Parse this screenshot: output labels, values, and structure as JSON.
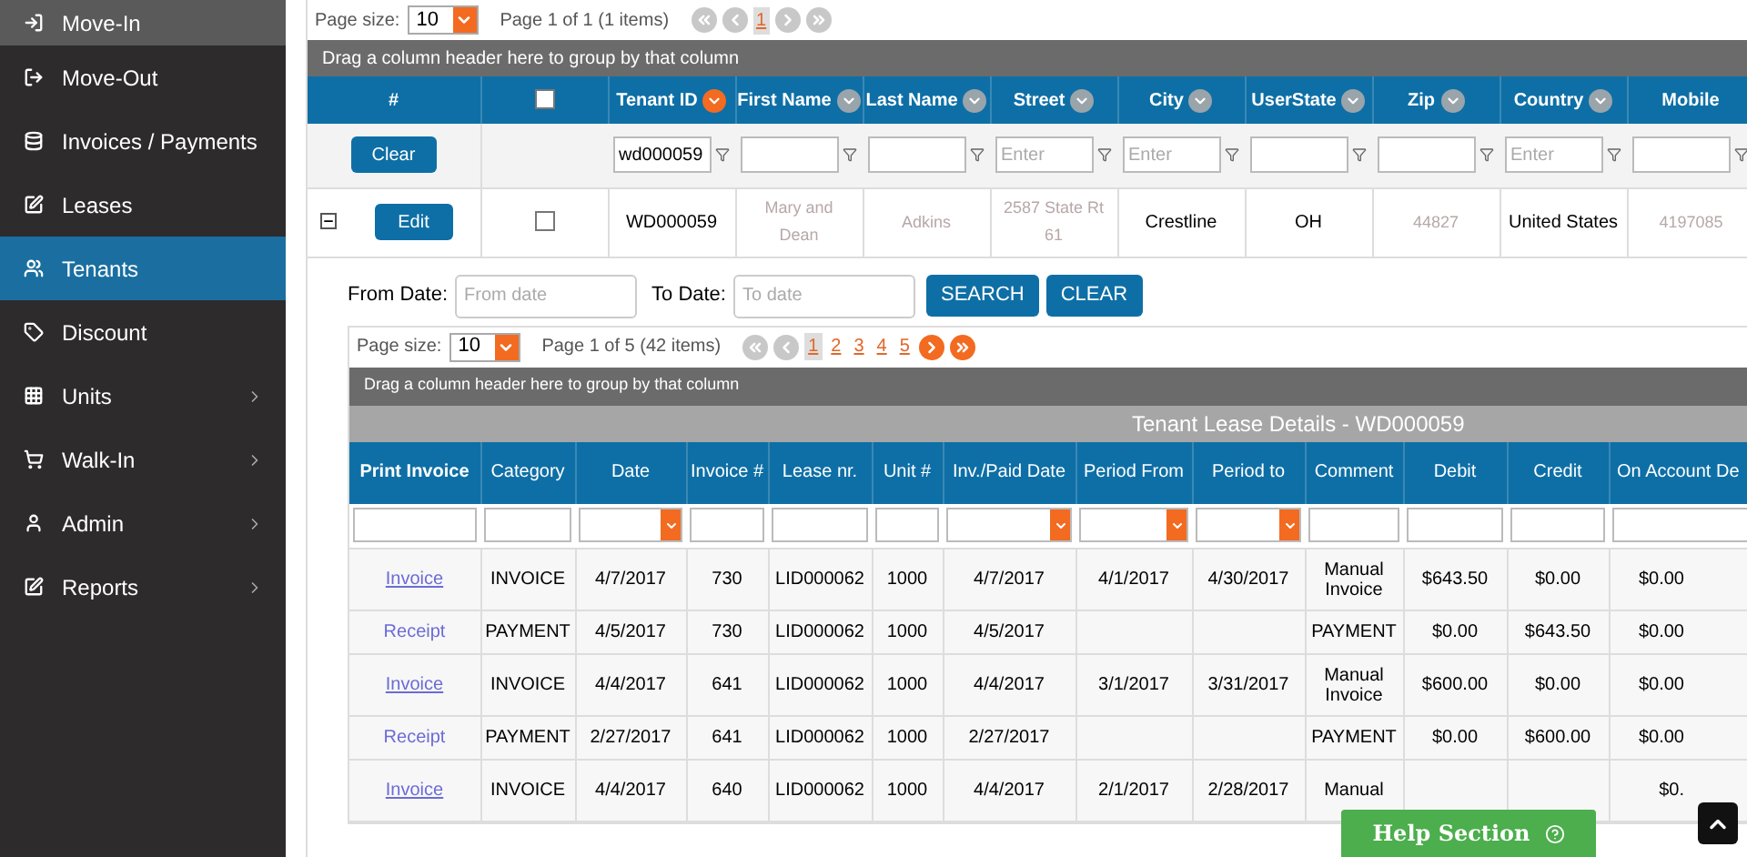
{
  "sidebar": {
    "items": [
      {
        "label": "Move-In",
        "selected": false,
        "hover": true,
        "submenu": false
      },
      {
        "label": "Move-Out",
        "selected": false,
        "hover": false,
        "submenu": false
      },
      {
        "label": "Invoices / Payments",
        "selected": false,
        "hover": false,
        "submenu": false
      },
      {
        "label": "Leases",
        "selected": false,
        "hover": false,
        "submenu": false
      },
      {
        "label": "Tenants",
        "selected": true,
        "hover": false,
        "submenu": false
      },
      {
        "label": "Discount",
        "selected": false,
        "hover": false,
        "submenu": false
      },
      {
        "label": "Units",
        "selected": false,
        "hover": false,
        "submenu": true
      },
      {
        "label": "Walk-In",
        "selected": false,
        "hover": false,
        "submenu": true
      },
      {
        "label": "Admin",
        "selected": false,
        "hover": false,
        "submenu": true
      },
      {
        "label": "Reports",
        "selected": false,
        "hover": false,
        "submenu": true
      }
    ]
  },
  "tenant_grid": {
    "page_size_label": "Page size:",
    "page_size": "10",
    "page_info": "Page 1 of 1 (1 items)",
    "pages": [
      {
        "label": "1",
        "selected": true
      }
    ],
    "next_enabled": false,
    "group_hint": "Drag a column header here to group by that column",
    "columns": [
      {
        "label": "#",
        "kind": "plain"
      },
      {
        "kind": "checkbox",
        "checked": false
      },
      {
        "label": "Tenant ID",
        "kind": "menu",
        "sorted": true
      },
      {
        "label": "First Name",
        "kind": "menu",
        "sorted": false
      },
      {
        "label": "Last Name",
        "kind": "menu",
        "sorted": false
      },
      {
        "label": "Street",
        "kind": "menu",
        "sorted": false
      },
      {
        "label": "City",
        "kind": "menu",
        "sorted": false
      },
      {
        "label": "UserState",
        "kind": "menu",
        "sorted": false
      },
      {
        "label": "Zip",
        "kind": "menu",
        "sorted": false
      },
      {
        "label": "Country",
        "kind": "menu",
        "sorted": false
      },
      {
        "label": "Mobile",
        "kind": "plain"
      }
    ],
    "clear_button": "Clear",
    "filters": [
      {
        "kind": "typed",
        "value": "wd000059"
      },
      {
        "kind": "blank"
      },
      {
        "kind": "blank"
      },
      {
        "kind": "hint",
        "placeholder": "Enter"
      },
      {
        "kind": "hint",
        "placeholder": "Enter"
      },
      {
        "kind": "blank"
      },
      {
        "kind": "blank"
      },
      {
        "kind": "hint",
        "placeholder": "Enter"
      },
      {
        "kind": "blank"
      }
    ],
    "row": {
      "expanded": true,
      "edit_button": "Edit",
      "checked": false,
      "cells": [
        "WD000059",
        "Mary and Dean",
        "Adkins",
        "2587 State Rt 61",
        "Crestline",
        "OH",
        "44827",
        "United States",
        "4197085"
      ],
      "redacted": [
        false,
        true,
        true,
        true,
        false,
        false,
        true,
        false,
        true
      ]
    }
  },
  "date_filter": {
    "from_label": "From Date:",
    "from_placeholder": "From date",
    "to_label": "To Date:",
    "to_placeholder": "To date",
    "search_button": "SEARCH",
    "clear_button": "CLEAR"
  },
  "lease_grid": {
    "page_size_label": "Page size:",
    "page_size": "10",
    "page_info": "Page 1 of 5 (42 items)",
    "pages": [
      {
        "label": "1",
        "selected": true
      },
      {
        "label": "2",
        "selected": false
      },
      {
        "label": "3",
        "selected": false
      },
      {
        "label": "4",
        "selected": false
      },
      {
        "label": "5",
        "selected": false
      }
    ],
    "next_enabled": true,
    "group_hint": "Drag a column header here to group by that column",
    "title": "Tenant Lease Details - WD000059",
    "columns": [
      {
        "label": "Print Invoice",
        "bold": true,
        "kind": "text"
      },
      {
        "label": "Category",
        "bold": false,
        "kind": "text"
      },
      {
        "label": "Date",
        "bold": false,
        "kind": "dropdown"
      },
      {
        "label": "Invoice #",
        "bold": false,
        "kind": "text"
      },
      {
        "label": "Lease nr.",
        "bold": false,
        "kind": "text"
      },
      {
        "label": "Unit #",
        "bold": false,
        "kind": "text"
      },
      {
        "label": "Inv./Paid Date",
        "bold": false,
        "kind": "dropdown"
      },
      {
        "label": "Period From",
        "bold": false,
        "kind": "dropdown"
      },
      {
        "label": "Period to",
        "bold": false,
        "kind": "dropdown"
      },
      {
        "label": "Comment",
        "bold": false,
        "kind": "text"
      },
      {
        "label": "Debit",
        "bold": false,
        "kind": "text"
      },
      {
        "label": "Credit",
        "bold": false,
        "kind": "text"
      },
      {
        "label": "On Account De",
        "bold": false,
        "kind": "text"
      }
    ],
    "rows": [
      {
        "kind": "invoice",
        "cells": [
          "Invoice",
          "INVOICE",
          "4/7/2017",
          "730",
          "LID000062",
          "1000",
          "4/7/2017",
          "4/1/2017",
          "4/30/2017",
          "Manual Invoice",
          "$643.50",
          "$0.00",
          "$0.00"
        ]
      },
      {
        "kind": "receipt",
        "cells": [
          "Receipt",
          "PAYMENT",
          "4/5/2017",
          "730",
          "LID000062",
          "1000",
          "4/5/2017",
          null,
          null,
          "PAYMENT",
          "$0.00",
          "$643.50",
          "$0.00"
        ]
      },
      {
        "kind": "invoice",
        "cells": [
          "Invoice",
          "INVOICE",
          "4/4/2017",
          "641",
          "LID000062",
          "1000",
          "4/4/2017",
          "3/1/2017",
          "3/31/2017",
          "Manual Invoice",
          "$600.00",
          "$0.00",
          "$0.00"
        ]
      },
      {
        "kind": "receipt",
        "cells": [
          "Receipt",
          "PAYMENT",
          "2/27/2017",
          "641",
          "LID000062",
          "1000",
          "2/27/2017",
          null,
          null,
          "PAYMENT",
          "$0.00",
          "$600.00",
          "$0.00"
        ]
      },
      {
        "kind": "invoice",
        "cells": [
          "Invoice",
          "INVOICE",
          "4/4/2017",
          "640",
          "LID000062",
          "1000",
          "4/4/2017",
          "2/1/2017",
          "2/28/2017",
          "Manual",
          null,
          null,
          "$0."
        ]
      }
    ]
  },
  "help_button": "Help Section"
}
